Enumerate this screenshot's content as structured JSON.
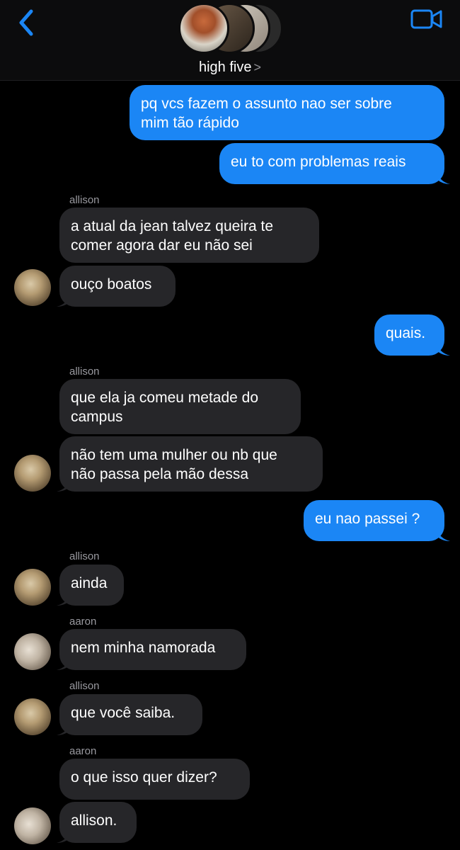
{
  "header": {
    "title": "high five",
    "chevron": ">",
    "back_icon": "chevron-left-icon",
    "video_icon": "video-camera-icon",
    "accent_color": "#1b86f5"
  },
  "messages": {
    "m1_line1": "pq vcs fazem o assunto nao ser sobre",
    "m1_line2": "mim tão rápido",
    "m2": "eu to com problemas reais",
    "s1": "allison",
    "m3_line1": "a atual da jean talvez queira te",
    "m3_line2": "comer agora dar eu não sei",
    "m4": "ouço boatos",
    "m5": "quais.",
    "s2": "allison",
    "m6_line1": "que ela ja comeu metade do",
    "m6_line2": "campus",
    "m7_line1": "não tem uma mulher ou nb que",
    "m7_line2": "não passa pela mão dessa",
    "m8": "eu nao passei ?",
    "s3": "allison",
    "m9": "ainda",
    "s4": "aaron",
    "m10": "nem minha namorada",
    "s5": "allison",
    "m11": "que você saiba.",
    "s6": "aaron",
    "m12": "o que isso quer dizer?",
    "m13": "allison."
  },
  "colors": {
    "outgoing_bubble": "#1b86f5",
    "incoming_bubble": "#262629",
    "background": "#000000"
  }
}
